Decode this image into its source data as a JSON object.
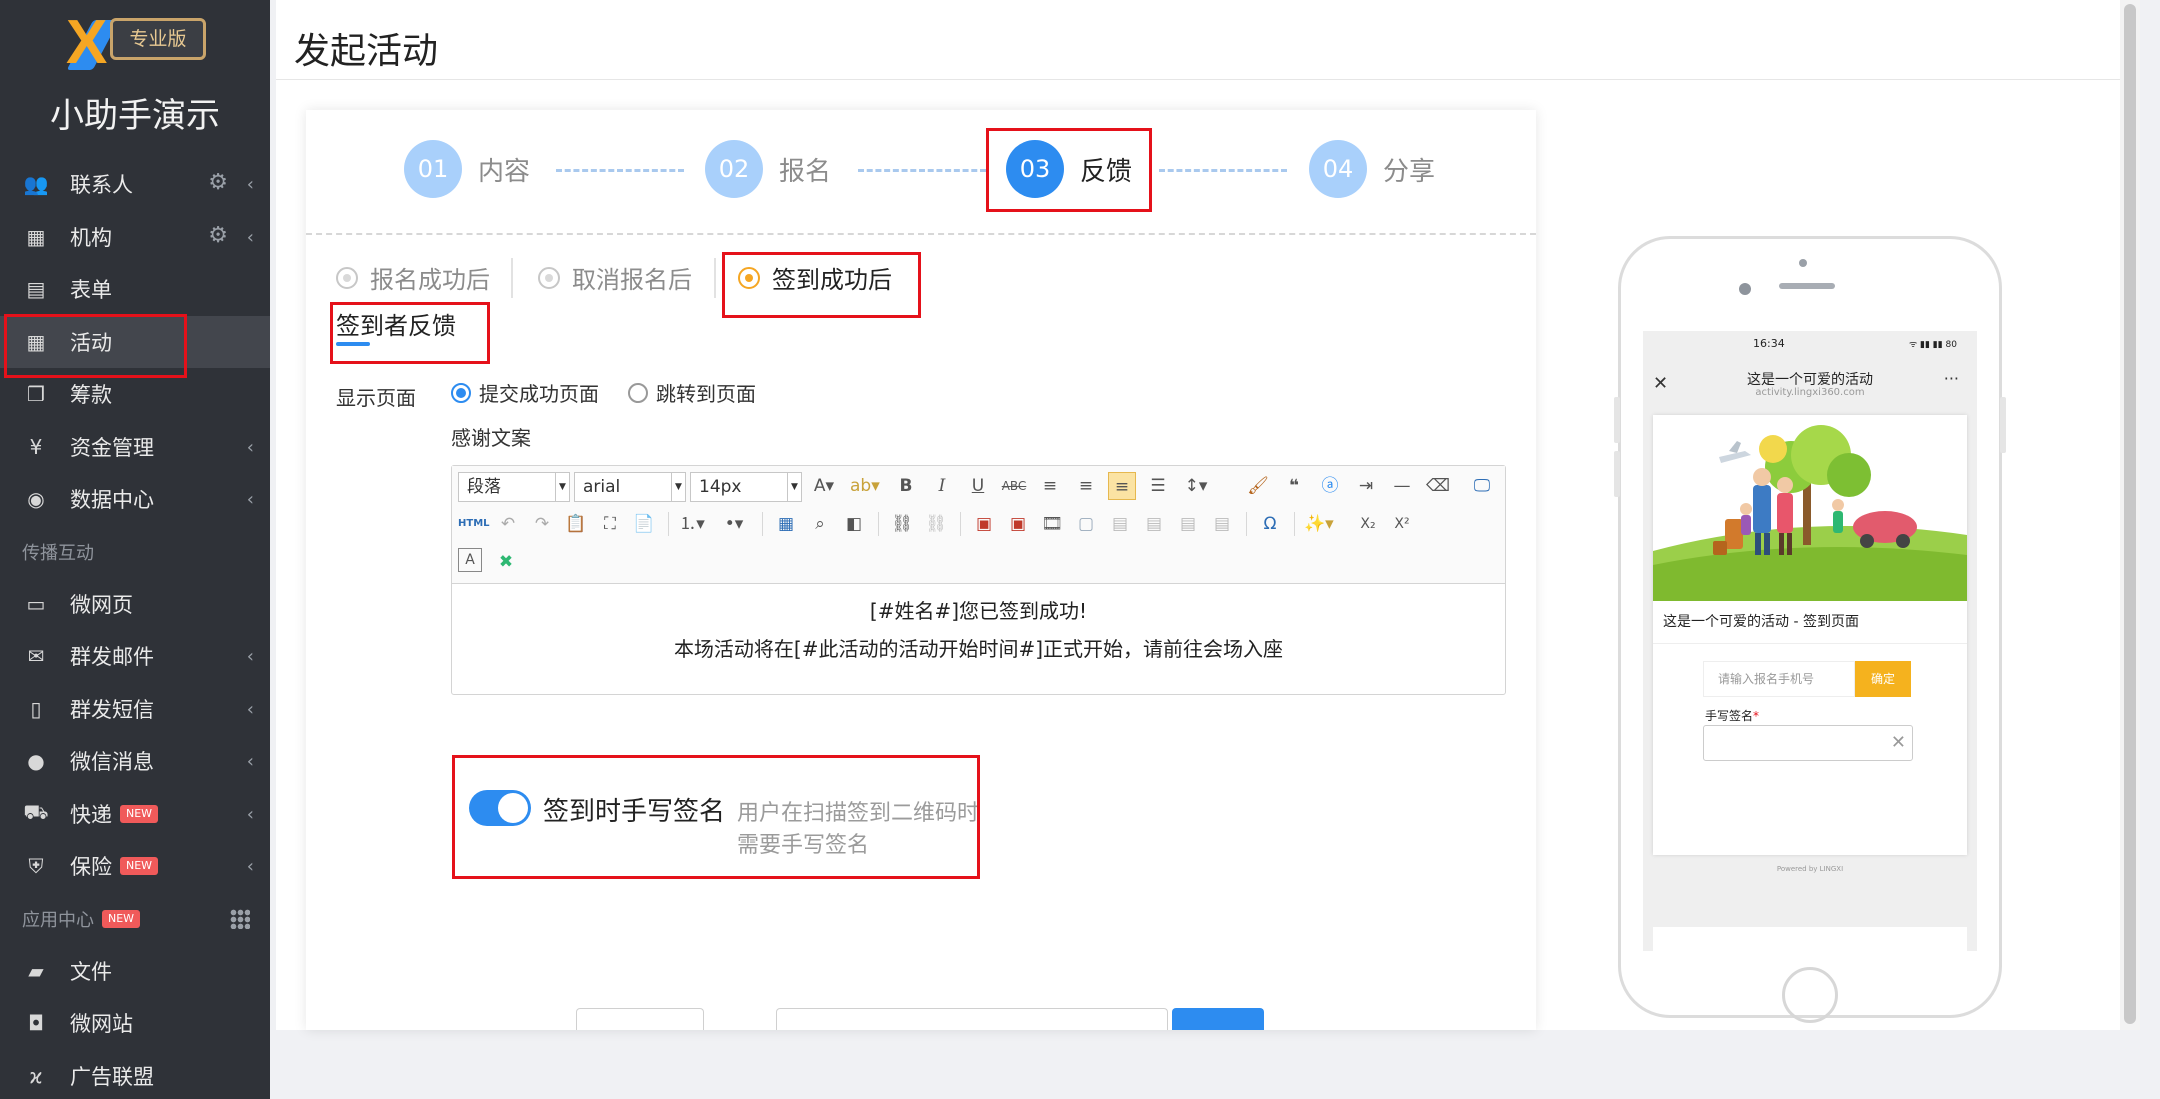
{
  "sidebar": {
    "logo_badge": "专业版",
    "app_title": "小助手演示",
    "items": [
      {
        "label": "联系人",
        "icon": "users-icon"
      },
      {
        "label": "机构",
        "icon": "building-icon"
      },
      {
        "label": "表单",
        "icon": "clipboard-icon"
      },
      {
        "label": "活动",
        "icon": "calendar-icon"
      },
      {
        "label": "筹款",
        "icon": "stack-icon"
      },
      {
        "label": "资金管理",
        "icon": "yen-icon"
      },
      {
        "label": "数据中心",
        "icon": "database-icon"
      }
    ],
    "section_spread": "传播互动",
    "spread_items": [
      {
        "label": "微网页",
        "icon": "page-icon"
      },
      {
        "label": "群发邮件",
        "icon": "mail-icon"
      },
      {
        "label": "群发短信",
        "icon": "mobile-icon"
      },
      {
        "label": "微信消息",
        "icon": "wechat-icon"
      },
      {
        "label": "快递",
        "icon": "truck-icon",
        "badge": "NEW"
      },
      {
        "label": "保险",
        "icon": "shield-icon",
        "badge": "NEW"
      }
    ],
    "section_apps": "应用中心",
    "section_apps_badge": "NEW",
    "app_items": [
      {
        "label": "文件",
        "icon": "folder-icon"
      },
      {
        "label": "微网站",
        "icon": "site-icon"
      },
      {
        "label": "广告联盟",
        "icon": "ad-icon"
      }
    ]
  },
  "page": {
    "title": "发起活动"
  },
  "steps": [
    {
      "num": "01",
      "label": "内容"
    },
    {
      "num": "02",
      "label": "报名"
    },
    {
      "num": "03",
      "label": "反馈"
    },
    {
      "num": "04",
      "label": "分享"
    }
  ],
  "tabs": [
    "报名成功后",
    "取消报名后",
    "签到成功后"
  ],
  "subtab": "签到者反馈",
  "form": {
    "display_label": "显示页面",
    "radio_submit": "提交成功页面",
    "radio_redirect": "跳转到页面",
    "thanks_label": "感谢文案"
  },
  "editor": {
    "paragraph": "段落",
    "font": "arial",
    "size": "14px",
    "html_label": "HTML",
    "line1": "[#姓名#]您已签到成功!",
    "line2": "本场活动将在[#此活动的活动开始时间#]正式开始，请前往会场入座"
  },
  "signature": {
    "title": "签到时手写签名",
    "desc": "用户在扫描签到二维码时需要手写签名",
    "enabled": true
  },
  "phone": {
    "time": "16:34",
    "status_right": "ᯤ ▮▮ ▮▮ 80",
    "title": "这是一个可爱的活动",
    "url": "activity.lingxi360.com",
    "caption": "这是一个可爱的活动 - 签到页面",
    "input_placeholder": "请输入报名手机号",
    "confirm": "确定",
    "sig_label": "手写签名",
    "required_mark": "*",
    "powered": "Powered  by  LINGXI"
  }
}
